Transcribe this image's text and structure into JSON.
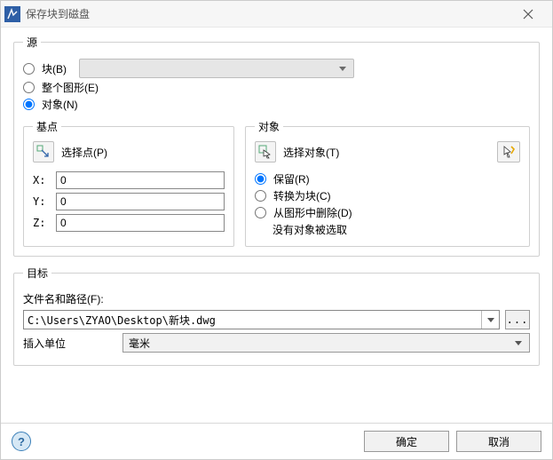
{
  "window": {
    "title": "保存块到磁盘"
  },
  "source": {
    "legend": "源",
    "block_label": "块(B)",
    "whole_label": "整个图形(E)",
    "objects_label": "对象(N)"
  },
  "basepoint": {
    "legend": "基点",
    "pick_label": "选择点(P)",
    "x_label": "X:",
    "y_label": "Y:",
    "z_label": "Z:",
    "x": "0",
    "y": "0",
    "z": "0"
  },
  "objects": {
    "legend": "对象",
    "pick_label": "选择对象(T)",
    "retain_label": "保留(R)",
    "convert_label": "转换为块(C)",
    "delete_label": "从图形中删除(D)",
    "none_selected": "没有对象被选取"
  },
  "dest": {
    "legend": "目标",
    "file_label": "文件名和路径(F):",
    "path": "C:\\Users\\ZYAO\\Desktop\\新块.dwg",
    "browse_label": "...",
    "units_label": "插入单位",
    "units_value": "毫米"
  },
  "footer": {
    "help": "?",
    "ok": "确定",
    "cancel": "取消"
  }
}
